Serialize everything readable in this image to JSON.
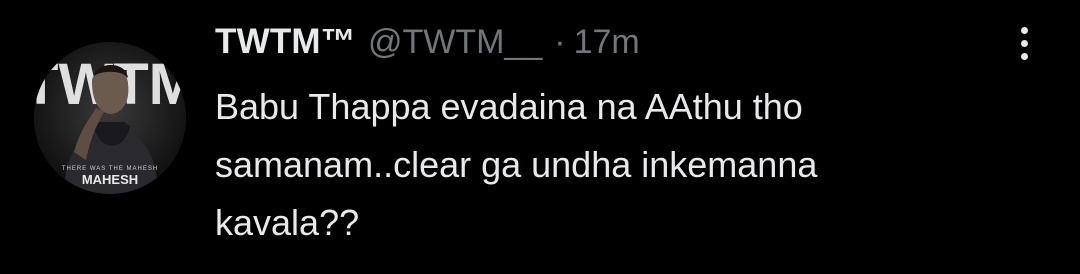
{
  "tweet": {
    "display_name": "TWTM™",
    "handle": "@TWTM__",
    "separator": "·",
    "time": "17m",
    "text_lines": [
      "Babu Thappa evadaina na AAthu tho",
      "samanam..clear ga undha inkemanna",
      "kavala??"
    ],
    "avatar": {
      "logo_text": "TWTM",
      "caption_small": "THERE WAS THE MAHESH",
      "caption_name": "MAHESH"
    },
    "menu_icon": "more-vertical-icon"
  }
}
